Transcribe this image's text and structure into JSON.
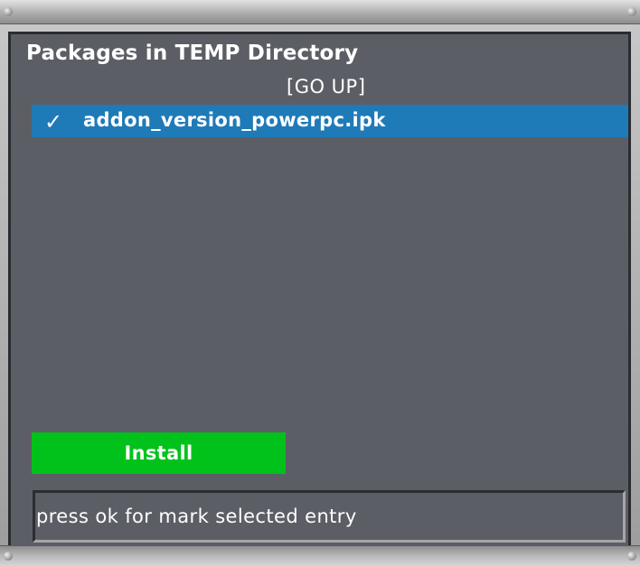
{
  "window": {
    "title": "Packages in TEMP Directory"
  },
  "navigation": {
    "go_up_label": "[GO UP]"
  },
  "file_list": {
    "items": [
      {
        "check": "✓",
        "name": "addon_version_powerpc.ipk",
        "marked": true,
        "selected": true
      }
    ]
  },
  "actions": {
    "install_label": "Install"
  },
  "status_bar": {
    "text": "press ok for mark selected entry"
  },
  "colors": {
    "panel_bg": "#5c5e66",
    "selection": "#1f7ab8",
    "install_button": "#00c21a",
    "text": "#ffffff"
  },
  "icons": {
    "check": "check-icon"
  }
}
